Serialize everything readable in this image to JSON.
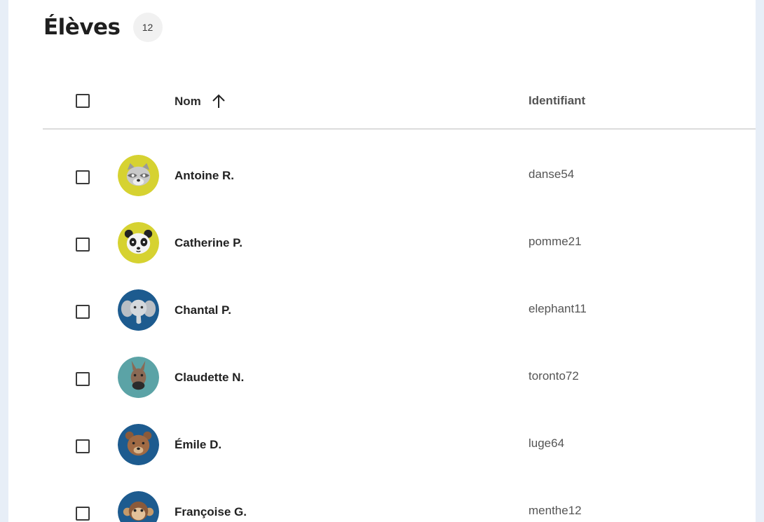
{
  "page": {
    "title": "Élèves",
    "count": "12"
  },
  "table": {
    "columns": {
      "name": "Nom",
      "id": "Identifiant"
    },
    "sort": {
      "column": "name",
      "direction": "ascending",
      "icon": "arrow-up-icon"
    },
    "rows": [
      {
        "name": "Antoine R.",
        "id": "danse54",
        "avatar": "raccoon-icon",
        "avatar_bg": "#d6d231"
      },
      {
        "name": "Catherine P.",
        "id": "pomme21",
        "avatar": "panda-icon",
        "avatar_bg": "#d6d231"
      },
      {
        "name": "Chantal P.",
        "id": "elephant11",
        "avatar": "elephant-icon",
        "avatar_bg": "#1d5b8f"
      },
      {
        "name": "Claudette N.",
        "id": "toronto72",
        "avatar": "donkey-icon",
        "avatar_bg": "#5ba3a6"
      },
      {
        "name": "Émile D.",
        "id": "luge64",
        "avatar": "bear-icon",
        "avatar_bg": "#1d5b8f"
      },
      {
        "name": "Françoise G.",
        "id": "menthe12",
        "avatar": "monkey-icon",
        "avatar_bg": "#1d5b8f"
      }
    ]
  },
  "colors": {
    "page_bg": "#e7eef7",
    "panel_bg": "#ffffff",
    "text": "#222222",
    "muted": "#555555",
    "divider": "#dcdcdc"
  }
}
